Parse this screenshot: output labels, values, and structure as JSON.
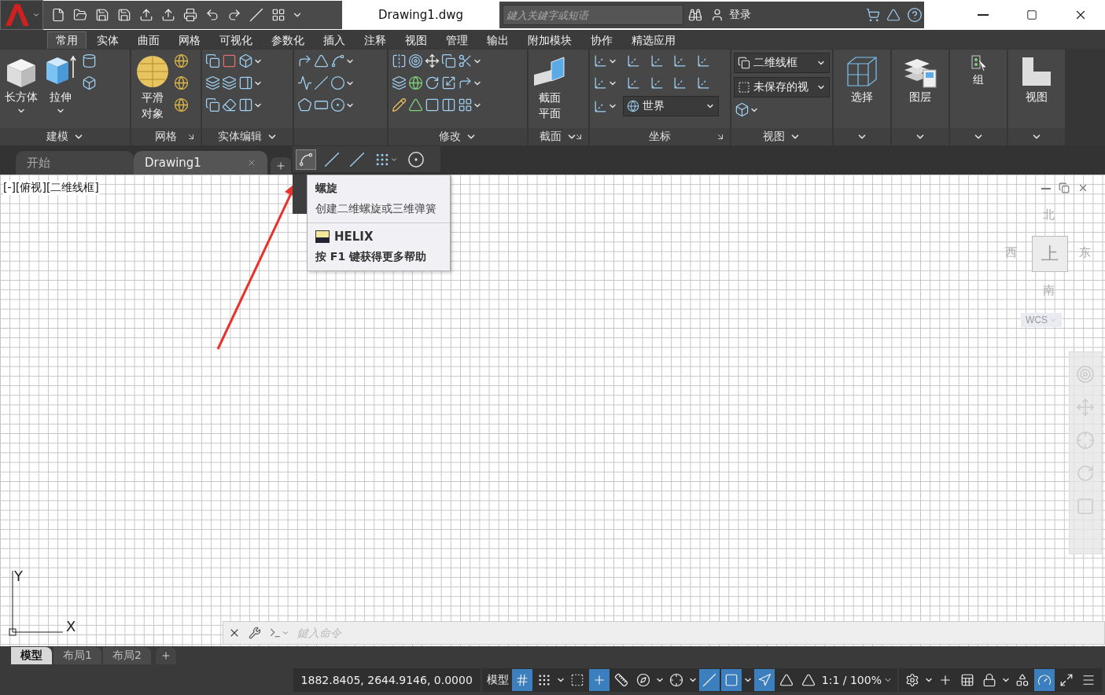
{
  "title_bar": {
    "title": "Drawing1.dwg",
    "search": {
      "placeholder": "鍵入关鍵字或短语"
    },
    "sign_in": "登录"
  },
  "ribbon_tabs": [
    {
      "label": "常用",
      "selected": true
    },
    {
      "label": "实体",
      "selected": false
    },
    {
      "label": "曲面",
      "selected": false
    },
    {
      "label": "网格",
      "selected": false
    },
    {
      "label": "可视化",
      "selected": false
    },
    {
      "label": "参数化",
      "selected": false
    },
    {
      "label": "插入",
      "selected": false
    },
    {
      "label": "注释",
      "selected": false
    },
    {
      "label": "视图",
      "selected": false
    },
    {
      "label": "管理",
      "selected": false
    },
    {
      "label": "输出",
      "selected": false
    },
    {
      "label": "附加模块",
      "selected": false
    },
    {
      "label": "协作",
      "selected": false
    },
    {
      "label": "精选应用",
      "selected": false
    }
  ],
  "ribbon_panels": [
    {
      "kind": "modeling",
      "title": "建模",
      "menu": true,
      "launcher": false,
      "buttons": [
        "长方体",
        "拉伸"
      ]
    },
    {
      "kind": "mesh",
      "title": "网格",
      "menu": false,
      "launcher": true,
      "buttons": [
        "平滑对象"
      ]
    },
    {
      "kind": "solid_edit",
      "title": "实体编辑",
      "menu": true,
      "launcher": false
    },
    {
      "kind": "draw"
    },
    {
      "kind": "modify",
      "title": "修改",
      "menu": true,
      "launcher": false
    },
    {
      "kind": "section",
      "title": "截面",
      "menu": true,
      "launcher": true,
      "buttons": [
        "截面平面"
      ]
    },
    {
      "kind": "coords",
      "title": "坐标",
      "menu": false,
      "launcher": true,
      "dropdowns": [
        "世界"
      ]
    },
    {
      "kind": "view_style",
      "title": "视图",
      "menu": true,
      "launcher": false,
      "dropdowns": [
        "二维线框",
        "未保存的视"
      ]
    },
    {
      "kind": "select",
      "menu": true,
      "buttons": [
        "选择"
      ]
    },
    {
      "kind": "layers",
      "menu": true,
      "buttons": [
        "图层"
      ]
    },
    {
      "kind": "groups",
      "menu": true,
      "buttons": [
        "组"
      ]
    },
    {
      "kind": "view_big",
      "menu": true,
      "buttons": [
        "视图"
      ]
    }
  ],
  "doc_tabs": [
    {
      "label": "开始",
      "selected": false,
      "closable": false
    },
    {
      "label": "Drawing1",
      "selected": true,
      "closable": true
    }
  ],
  "viewport_label": "[-][俯视][二维线框]",
  "tooltip": {
    "title": "螺旋",
    "description": "创建二维螺旋或三维弹簧",
    "command": "HELIX",
    "help": "按 F1 键获得更多帮助"
  },
  "viewcube": {
    "north": "北",
    "west": "西",
    "face": "上",
    "east": "东",
    "south": "南",
    "wcs": "WCS"
  },
  "ucs": {
    "y": "Y",
    "x": "X"
  },
  "command_line": {
    "placeholder": "鍵入命令"
  },
  "layout_tabs": [
    {
      "label": "模型",
      "selected": true
    },
    {
      "label": "布局1",
      "selected": false
    },
    {
      "label": "布局2",
      "selected": false
    }
  ],
  "status_bar": {
    "coordinates": "1882.8405, 2644.9146, 0.0000",
    "space": "模型",
    "scale": "1:1 / 100%",
    "toggles": [
      {
        "kind": "grid",
        "on": true
      },
      {
        "kind": "snap",
        "on": false
      },
      {
        "kind": "infer",
        "on": false
      },
      {
        "kind": "dynamic",
        "on": true
      },
      {
        "kind": "ortho",
        "on": false
      },
      {
        "kind": "polar",
        "on": false
      },
      {
        "kind": "iso",
        "on": false
      },
      {
        "kind": "track",
        "on": true
      },
      {
        "kind": "osnap",
        "on": true
      },
      {
        "kind": "annot_visible",
        "on": true
      },
      {
        "kind": "autoscale",
        "on": false
      },
      {
        "kind": "annot_scale",
        "on": false
      }
    ],
    "tools": [
      {
        "kind": "settings",
        "on": false
      },
      {
        "kind": "plus",
        "on": false
      },
      {
        "kind": "properties",
        "on": false
      },
      {
        "kind": "lock",
        "on": false
      },
      {
        "kind": "isolate",
        "on": false
      },
      {
        "kind": "hardware",
        "on": true
      },
      {
        "kind": "fullscreen",
        "on": false
      },
      {
        "kind": "customize",
        "on": false
      }
    ]
  }
}
